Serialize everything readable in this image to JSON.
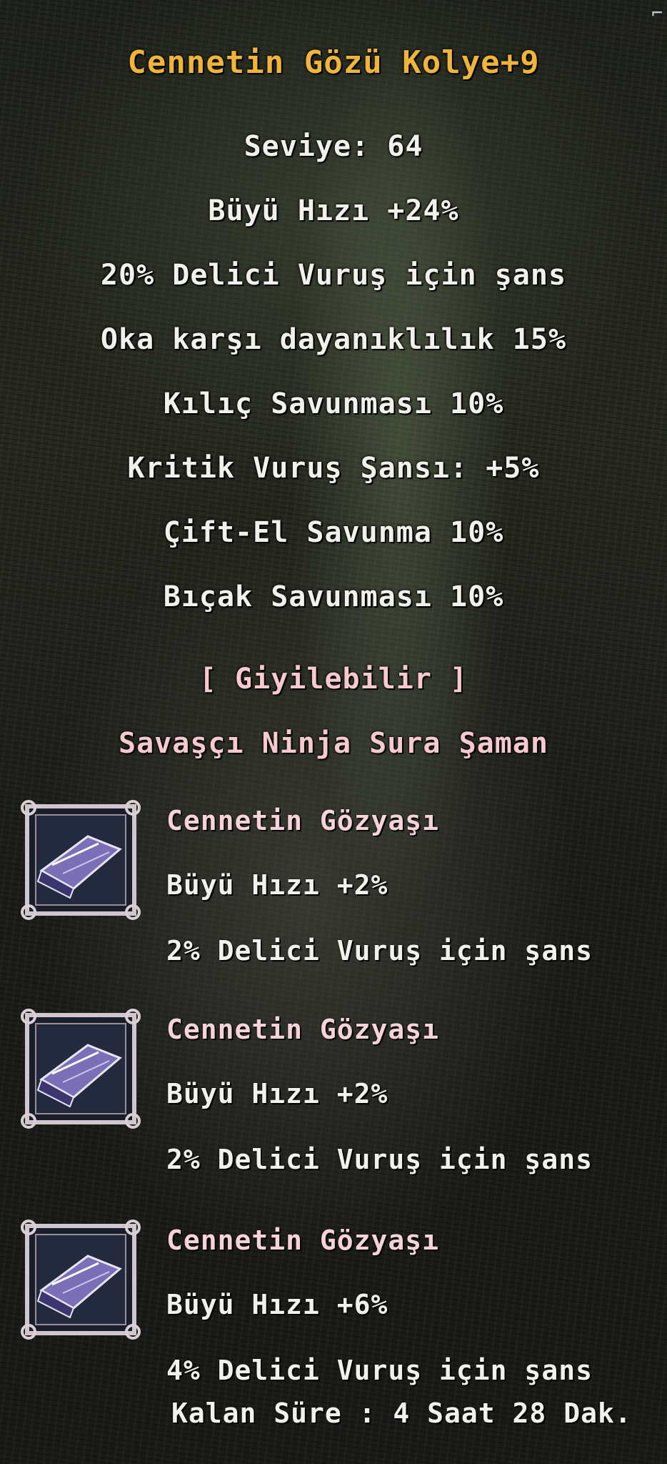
{
  "tooltip": {
    "title": "Cennetin Gözü Kolye+9",
    "level": "Seviye: 64",
    "bonuses": [
      "Büyü Hızı +24%",
      "20% Delici Vuruş için şans",
      "Oka karşı dayanıklılık 15%",
      "Kılıç Savunması 10%",
      "Kritik Vuruş Şansı: +5%",
      "Çift-El Savunma 10%",
      "Bıçak Savunması 10%"
    ],
    "wearable_label": "[ Giyilebilir ]",
    "wearable_classes": "Savaşçı Ninja Sura Şaman",
    "stones": [
      {
        "icon": "crystal-tear-stone-icon",
        "name": "Cennetin Gözyaşı",
        "stat1": "Büyü Hızı +2%",
        "stat2": "2% Delici Vuruş için şans"
      },
      {
        "icon": "crystal-tear-stone-icon",
        "name": "Cennetin Gözyaşı",
        "stat1": "Büyü Hızı +2%",
        "stat2": "2% Delici Vuruş için şans"
      },
      {
        "icon": "crystal-tear-stone-icon",
        "name": "Cennetin Gözyaşı",
        "stat1": "Büyü Hızı +6%",
        "stat2": "4% Delici Vuruş için şans"
      }
    ],
    "remaining_time": "Kalan Süre : 4 Saat 28 Dak.",
    "colors": {
      "title": "#f0b43a",
      "text": "#f1f0ea",
      "pink": "#f6c9cf"
    }
  }
}
